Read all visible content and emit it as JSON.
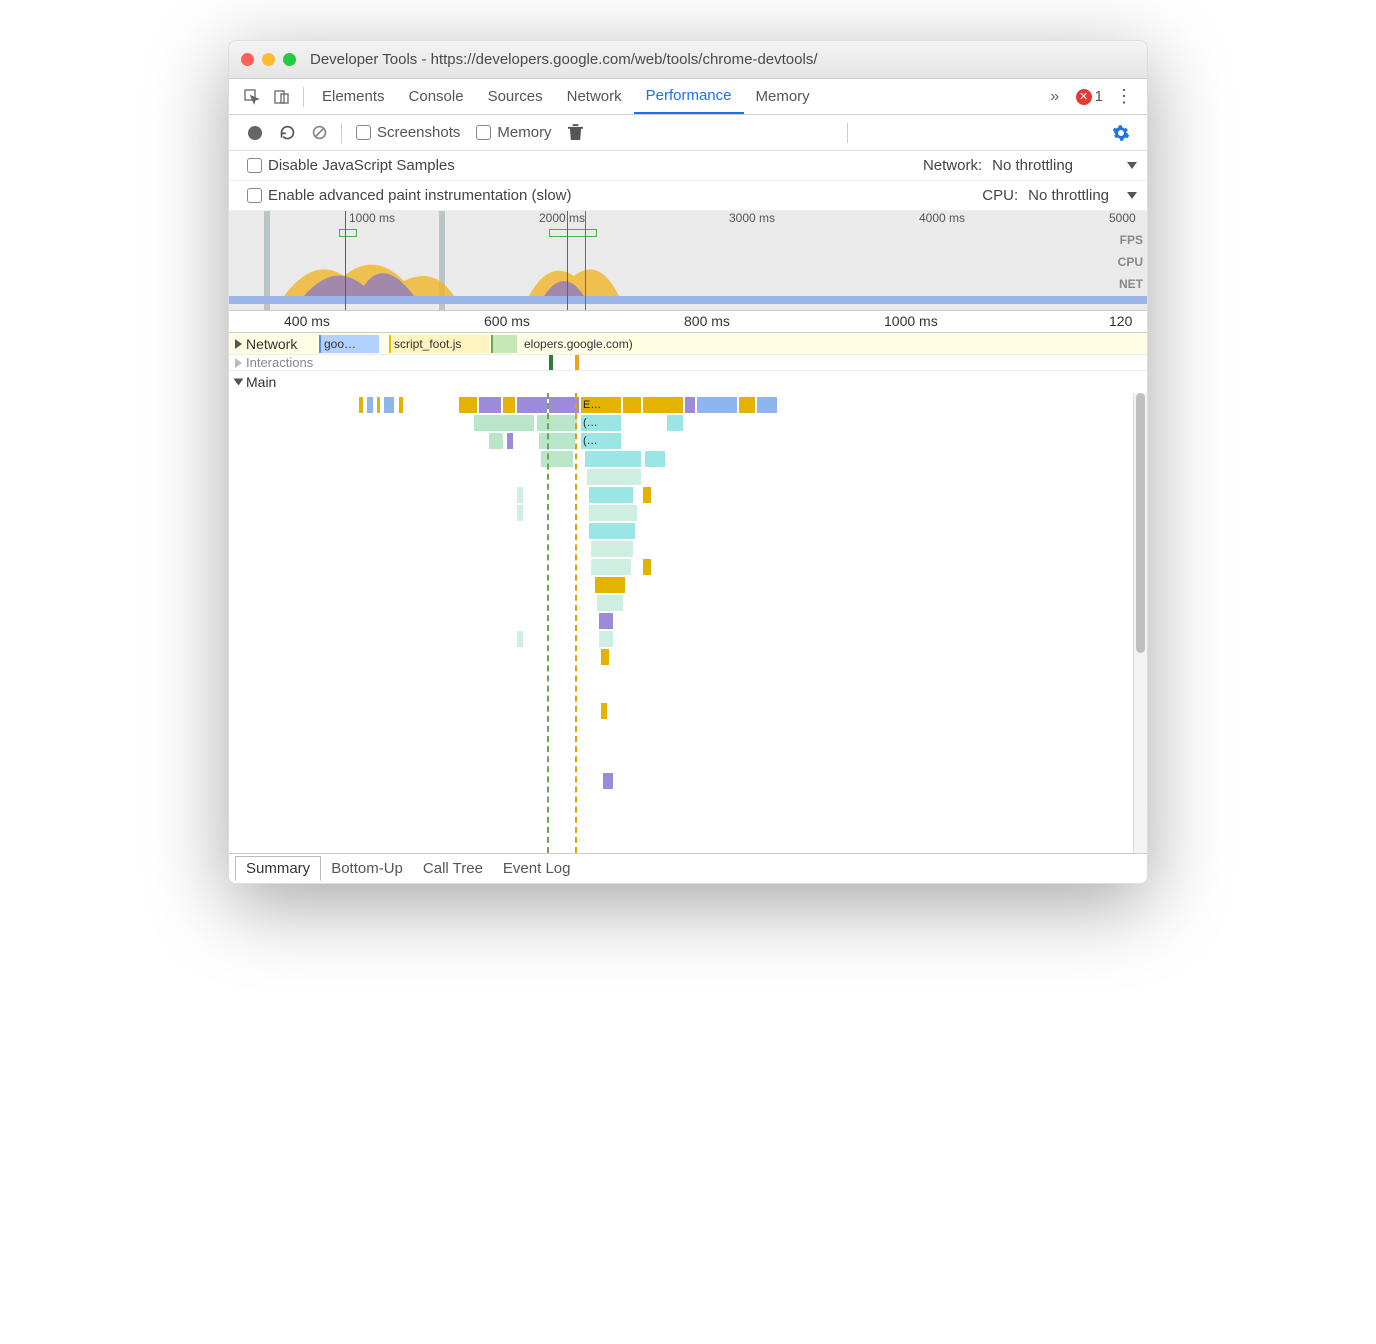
{
  "window": {
    "title": "Developer Tools - https://developers.google.com/web/tools/chrome-devtools/"
  },
  "tabs": {
    "items": [
      "Elements",
      "Console",
      "Sources",
      "Network",
      "Performance",
      "Memory"
    ],
    "active": "Performance",
    "error_count": "1"
  },
  "toolbar2": {
    "screenshots_label": "Screenshots",
    "memory_label": "Memory"
  },
  "settings": {
    "disable_js": "Disable JavaScript Samples",
    "network_label": "Network:",
    "network_value": "No throttling",
    "paint_instr": "Enable advanced paint instrumentation (slow)",
    "cpu_label": "CPU:",
    "cpu_value": "No throttling"
  },
  "overview": {
    "ticks": [
      "1000 ms",
      "2000 ms",
      "3000 ms",
      "4000 ms",
      "5000"
    ],
    "lanes": [
      "FPS",
      "CPU",
      "NET"
    ]
  },
  "detail_ruler": [
    "400 ms",
    "600 ms",
    "800 ms",
    "1000 ms",
    "120"
  ],
  "tracks": {
    "network_label": "Network",
    "net_item1": "goo…",
    "net_item2": "script_foot.js",
    "net_item3": "elopers.google.com)",
    "interactions_label": "Interactions",
    "main_label": "Main"
  },
  "flame": {
    "e_label": "E…",
    "anon1": "(…",
    "anon2": "(…"
  },
  "bottom_tabs": {
    "items": [
      "Summary",
      "Bottom-Up",
      "Call Tree",
      "Event Log"
    ],
    "active": "Summary"
  }
}
